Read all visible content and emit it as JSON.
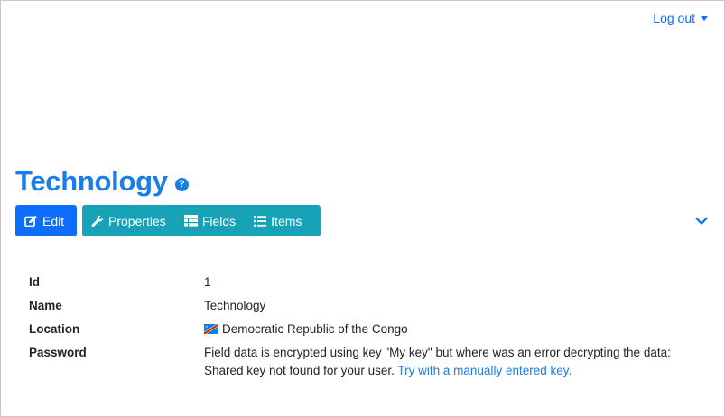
{
  "header": {
    "logout_label": "Log out"
  },
  "page": {
    "title": "Technology",
    "help_symbol": "?"
  },
  "toolbar": {
    "edit_label": "Edit",
    "properties_label": "Properties",
    "fields_label": "Fields",
    "items_label": "Items"
  },
  "details": {
    "rows": [
      {
        "label": "Id",
        "value": "1"
      },
      {
        "label": "Name",
        "value": "Technology"
      },
      {
        "label": "Location",
        "value": "Democratic Republic of the Congo"
      },
      {
        "label": "Password",
        "value": "Field data is encrypted using key \"My key\" but where was an error decrypting the data: Shared key not found for your user.",
        "link_text": "Try with a manually entered key."
      }
    ]
  },
  "colors": {
    "primary": "#0d6efd",
    "info": "#17a2b8",
    "title": "#1a7ee6"
  },
  "icons": {
    "edit": "pen-square-icon",
    "properties": "wrench-icon",
    "fields": "table-icon",
    "items": "list-icon",
    "expand": "chevron-down-icon",
    "help": "question-circle-icon",
    "flag": "flag-drc-icon"
  }
}
